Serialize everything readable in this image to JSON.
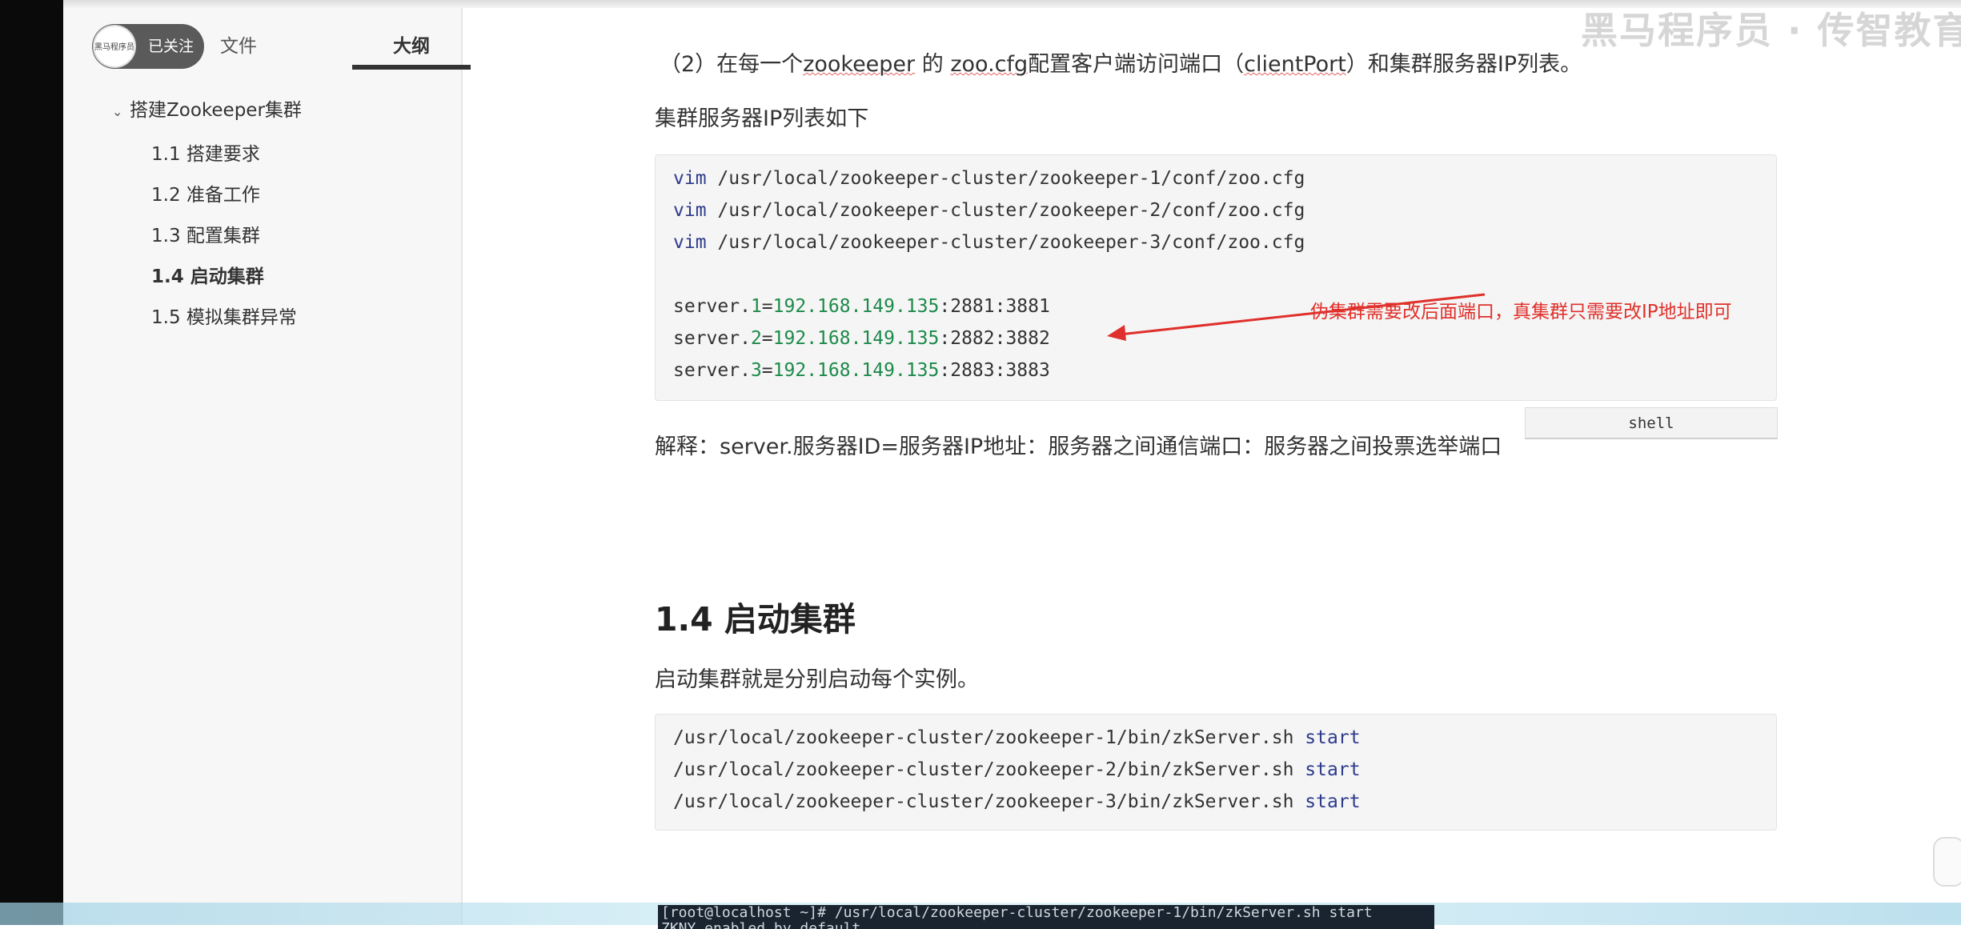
{
  "header": {
    "follow_label": "已关注",
    "avatar_text": "黑马程序员",
    "tabs": [
      {
        "label": "文件",
        "active": false
      },
      {
        "label": "大纲",
        "active": true
      }
    ],
    "watermark": "黑马程序员 · 传智教育"
  },
  "outline": {
    "root": "搭建Zookeeper集群",
    "items": [
      {
        "label": "1.1 搭建要求",
        "active": false
      },
      {
        "label": "1.2 准备工作",
        "active": false
      },
      {
        "label": "1.3 配置集群",
        "active": false
      },
      {
        "label": "1.4 启动集群",
        "active": true
      },
      {
        "label": "1.5 模拟集群异常",
        "active": false
      }
    ]
  },
  "content": {
    "para_config": {
      "prefix": "（2）在每一个",
      "w1": "zookeeper",
      "mid1": " 的 ",
      "w2": "zoo.cfg",
      "mid2": "配置客户端访问端口（",
      "w3": "clientPort",
      "suffix": "）和集群服务器IP列表。"
    },
    "para_iplist": "集群服务器IP列表如下",
    "code1": {
      "vim": [
        {
          "cmd": "vim",
          "path": " /usr/local/zookeeper-cluster/zookeeper-1/conf/zoo.cfg"
        },
        {
          "cmd": "vim",
          "path": " /usr/local/zookeeper-cluster/zookeeper-2/conf/zoo.cfg"
        },
        {
          "cmd": "vim",
          "path": " /usr/local/zookeeper-cluster/zookeeper-3/conf/zoo.cfg"
        }
      ],
      "servers": [
        {
          "pre": "server.",
          "id": "1",
          "eq": "=",
          "ip": "192.168.149.135",
          "ports": ":2881:3881"
        },
        {
          "pre": "server.",
          "id": "2",
          "eq": "=",
          "ip": "192.168.149.135",
          "ports": ":2882:3882"
        },
        {
          "pre": "server.",
          "id": "3",
          "eq": "=",
          "ip": "192.168.149.135",
          "ports": ":2883:3883"
        }
      ],
      "annotation": "伪集群需要改后面端口，真集群只需要改IP地址即可",
      "lang": "shell"
    },
    "para_explain": "解释：server.服务器ID=服务器IP地址：服务器之间通信端口：服务器之间投票选举端口",
    "heading": "1.4 启动集群",
    "para_start": "启动集群就是分别启动每个实例。",
    "code2": [
      {
        "path": "/usr/local/zookeeper-cluster/zookeeper-1/bin/zkServer.sh",
        "cmd": " start"
      },
      {
        "path": "/usr/local/zookeeper-cluster/zookeeper-2/bin/zkServer.sh",
        "cmd": " start"
      },
      {
        "path": "/usr/local/zookeeper-cluster/zookeeper-3/bin/zkServer.sh",
        "cmd": " start"
      }
    ],
    "terminal": "[root@localhost ~]# /usr/local/zookeeper-cluster/zookeeper-1/bin/zkServer.sh start\nZKNY enabled by default"
  },
  "colors": {
    "keyword": "#2e3a8c",
    "number": "#1d8a4a",
    "annotation": "#e0302b"
  }
}
